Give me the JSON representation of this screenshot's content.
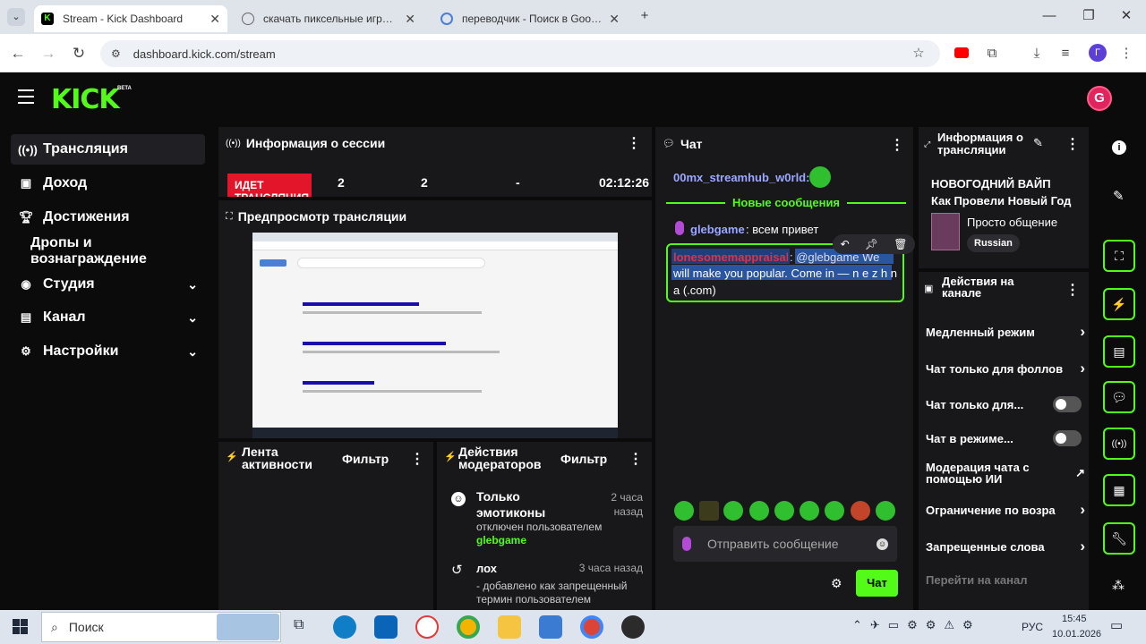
{
  "browser": {
    "tabs": [
      {
        "title": "Stream - Kick Dashboard",
        "active": true
      },
      {
        "title": "скачать пиксельные игры на",
        "active": false
      },
      {
        "title": "переводчик - Поиск в Google",
        "active": false
      }
    ],
    "url": "dashboard.kick.com/stream",
    "profile_initial": "Г"
  },
  "app": {
    "logo": "KICK",
    "logo_badge": "BETA",
    "accent": "#53fc18",
    "nav": [
      {
        "label": "Трансляция",
        "icon": "broadcast-icon",
        "active": true
      },
      {
        "label": "Доход",
        "icon": "revenue-icon"
      },
      {
        "label": "Достижения",
        "icon": "trophy-icon"
      },
      {
        "label": "Дропы и вознаграждение"
      },
      {
        "label": "Студия",
        "icon": "studio-icon",
        "expandable": true
      },
      {
        "label": "Канал",
        "icon": "channel-icon",
        "expandable": true
      },
      {
        "label": "Настройки",
        "icon": "gear-icon",
        "expandable": true
      }
    ]
  },
  "session": {
    "title": "Информация о сессии",
    "live_label": "ИДЕТ ТРАНСЛЯЦИЯ",
    "stat1": "2",
    "stat2": "2",
    "stat3": "-",
    "duration": "02:12:26"
  },
  "preview": {
    "title": "Предпросмотр трансляции"
  },
  "activity": {
    "title": "Лента активности",
    "filter": "Фильтр"
  },
  "modactions": {
    "title": "Действия модераторов",
    "filter": "Фильтр",
    "items": [
      {
        "title": "Только эмотиконы",
        "time": "2 часа назад",
        "desc": "отключен пользователем",
        "user": "glebgame"
      },
      {
        "title": "лох",
        "time": "3 часа назад",
        "desc": "- добавлено как запрещенный термин пользователем"
      }
    ]
  },
  "chat": {
    "title": "Чат",
    "msg0_user": "00mx_streamhub_w0rld:",
    "new_messages": "Новые сообщения",
    "msg1_user": "glebgame",
    "msg1_text": ": всем привет",
    "msg2_user": "lonesomemappraisals",
    "msg2_text_line1": ": @glebgame We",
    "msg2_text_line2": "will make you popular. Come in — n e z h n",
    "msg2_text_line3": "a (.com)",
    "input_placeholder": "Отправить сообщение",
    "send_button": "Чат"
  },
  "stream_info": {
    "title": "Информация о трансляции",
    "stream_title_line1": "НОВОГОДНИЙ ВАЙП",
    "stream_title_line2": "Как Провели Новый Год",
    "category": "Просто общение",
    "language": "Russian"
  },
  "channel_actions": {
    "title": "Действия на канале",
    "items": [
      {
        "label": "Медленный режим",
        "control": "chevron"
      },
      {
        "label": "Чат только для фоллов",
        "control": "chevron"
      },
      {
        "label": "Чат только для...",
        "control": "toggle"
      },
      {
        "label": "Чат в режиме...",
        "control": "toggle"
      },
      {
        "label": "Модерация чата с помощью ИИ",
        "control": "external"
      },
      {
        "label": "Ограничение по возра",
        "control": "chevron"
      },
      {
        "label": "Запрещенные слова",
        "control": "chevron"
      },
      {
        "label": "Перейти на канал",
        "control": "none"
      }
    ]
  },
  "taskbar": {
    "search_placeholder": "Поиск",
    "lang": "РУС",
    "time": "15:45",
    "date": "10.01.2026"
  }
}
